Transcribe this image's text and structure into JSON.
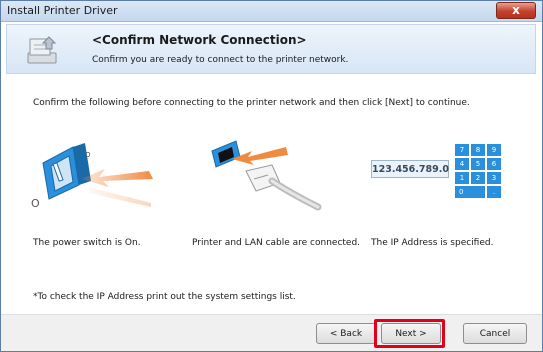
{
  "window": {
    "title": "Install Printer Driver",
    "close_label": "x"
  },
  "header": {
    "title": "<Confirm Network Connection>",
    "subtitle": "Confirm you are ready to connect to the printer network."
  },
  "instruction": "Confirm the following before connecting to the printer network and then click [Next] to continue.",
  "steps": [
    {
      "caption": "The power switch is On.",
      "icon": "power-switch-icon"
    },
    {
      "caption": "Printer and LAN cable are connected.",
      "icon": "lan-cable-icon"
    },
    {
      "caption": "The IP Address is specified.",
      "icon": "ip-keypad-icon"
    }
  ],
  "ip_display": "123.456.789.0",
  "keypad": [
    "7",
    "8",
    "9",
    "4",
    "5",
    "6",
    "1",
    "2",
    "3",
    "0",
    "."
  ],
  "power_labels": {
    "on": "O",
    "off": "O"
  },
  "ip_note": "*To check the IP Address print out the system settings list.",
  "buttons": {
    "back": "< Back",
    "next": "Next >",
    "cancel": "Cancel"
  },
  "colors": {
    "accent_blue": "#2a8fdc",
    "arrow_orange": "#f08a40",
    "highlight_red": "#e0001a"
  }
}
